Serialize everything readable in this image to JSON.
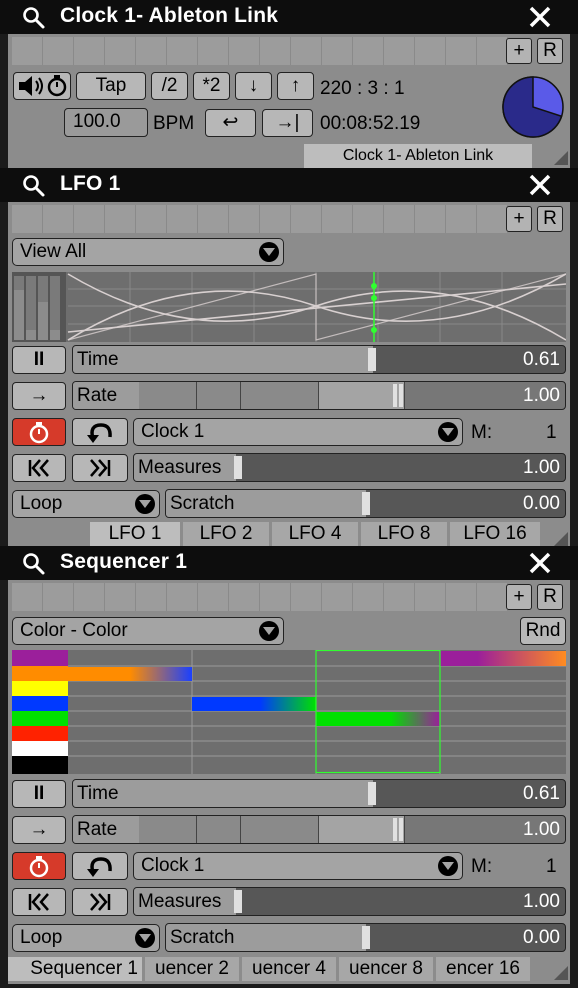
{
  "clock": {
    "title": "Clock 1- Ableton Link",
    "strip_plus": "+",
    "strip_r": "R",
    "tap": "Tap",
    "div2": "/2",
    "mul2": "*2",
    "down": "↓",
    "up": "↑",
    "position": "220 : 3 : 1",
    "bpm_value": "100.0",
    "bpm_label": "BPM",
    "return_label": "↩",
    "end_label": "→|",
    "elapsed": "00:08:52.19",
    "tab": "Clock 1- Ableton Link",
    "pie_fraction": 0.7
  },
  "lfo": {
    "title": "LFO 1",
    "strip_plus": "+",
    "strip_r": "R",
    "view": "View All",
    "play": "II",
    "time_label": "Time",
    "time_value": "0.61",
    "time_fraction": 0.61,
    "rate_btn": "→",
    "rate_label": "Rate",
    "rate_value": "1.00",
    "clock_select": "Clock 1",
    "m_label": "M:",
    "m_value": "1",
    "rew": "K",
    "fwd": "»",
    "measures_label": "Measures",
    "measures_value": "1.00",
    "mode": "Loop",
    "scratch_label": "Scratch",
    "scratch_value": "0.00",
    "tabs": [
      "LFO 1",
      "LFO 2",
      "LFO 4",
      "LFO 8",
      "LFO 16"
    ]
  },
  "seq": {
    "title": "Sequencer 1",
    "strip_plus": "+",
    "strip_r": "R",
    "view": "Color - Color",
    "rnd": "Rnd",
    "play": "II",
    "time_label": "Time",
    "time_value": "0.61",
    "rate_btn": "→",
    "rate_label": "Rate",
    "rate_value": "1.00",
    "clock_select": "Clock 1",
    "m_label": "M:",
    "m_value": "1",
    "measures_label": "Measures",
    "measures_value": "1.00",
    "mode": "Loop",
    "scratch_label": "Scratch",
    "scratch_value": "0.00",
    "tabs": [
      "Sequencer 1",
      "uencer 2",
      "uencer 4",
      "uencer 8",
      "encer 16"
    ],
    "palette": [
      "#9b1f9b",
      "#ff8c00",
      "#ffff00",
      "#0039ff",
      "#00e000",
      "#ff2200",
      "#ffffff",
      "#000000"
    ]
  },
  "colors": {
    "accent_red": "#d63a2a",
    "lfo_marker": "#30ff30"
  }
}
